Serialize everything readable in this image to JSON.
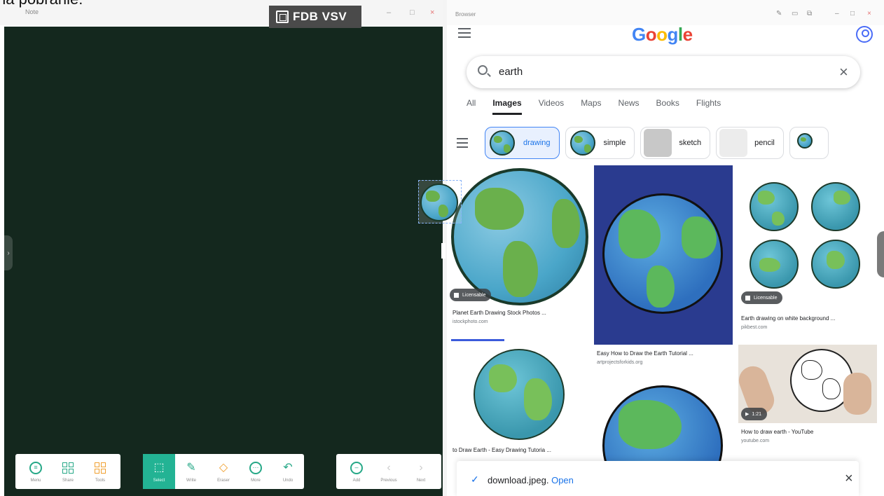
{
  "caption_top": "na pobranie:",
  "note_app": {
    "title": "Note",
    "badge_text": "FDB VSV",
    "window_controls": [
      "–",
      "□",
      "×"
    ],
    "side_handle": "›",
    "toolbar_left": [
      {
        "label": "Menu",
        "icon": "menu-icon"
      },
      {
        "label": "Share",
        "icon": "share-icon"
      },
      {
        "label": "Tools",
        "icon": "tools-icon"
      }
    ],
    "toolbar_center": [
      {
        "label": "Select",
        "icon": "select-icon",
        "active": true
      },
      {
        "label": "Write",
        "icon": "pen-icon"
      },
      {
        "label": "Eraser",
        "icon": "eraser-icon"
      },
      {
        "label": "More",
        "icon": "more-icon"
      },
      {
        "label": "Undo",
        "icon": "undo-icon"
      }
    ],
    "toolbar_right": [
      {
        "label": "Add",
        "icon": "add-page-icon"
      },
      {
        "label": "Previous",
        "icon": "previous-icon"
      },
      {
        "label": "Next",
        "icon": "next-icon"
      }
    ],
    "board_color": "#14281e",
    "active_tool_color": "#23b394"
  },
  "browser": {
    "title": "Browser",
    "window_controls": [
      "–",
      "□",
      "×"
    ],
    "logo_letters": [
      {
        "ch": "G",
        "color": "#4285f4"
      },
      {
        "ch": "o",
        "color": "#ea4335"
      },
      {
        "ch": "o",
        "color": "#fbbc05"
      },
      {
        "ch": "g",
        "color": "#4285f4"
      },
      {
        "ch": "l",
        "color": "#34a853"
      },
      {
        "ch": "e",
        "color": "#ea4335"
      }
    ],
    "search": {
      "value": "earth"
    },
    "tabs": [
      "All",
      "Images",
      "Videos",
      "Maps",
      "News",
      "Books",
      "Flights"
    ],
    "active_tab": "Images",
    "chips": [
      "drawing",
      "simple",
      "sketch",
      "pencil"
    ],
    "results": [
      {
        "caption": "Planet Earth Drawing Stock Photos ...",
        "source": "istockphoto.com",
        "badge": "Licensable"
      },
      {
        "caption": "Easy How to Draw the Earth Tutorial ...",
        "source": "artprojectsforkids.org"
      },
      {
        "caption": "Earth drawing on white background ...",
        "source": "pikbest.com",
        "badge": "Licensable"
      },
      {
        "caption": "to Draw Earth - Easy Drawing Tutoria ...",
        "source": ""
      },
      {
        "caption": "How to draw earth - YouTube",
        "source": "youtube.com",
        "badge": "1:21"
      }
    ],
    "download": {
      "file": "download.jpeg.",
      "action": "Open"
    }
  }
}
